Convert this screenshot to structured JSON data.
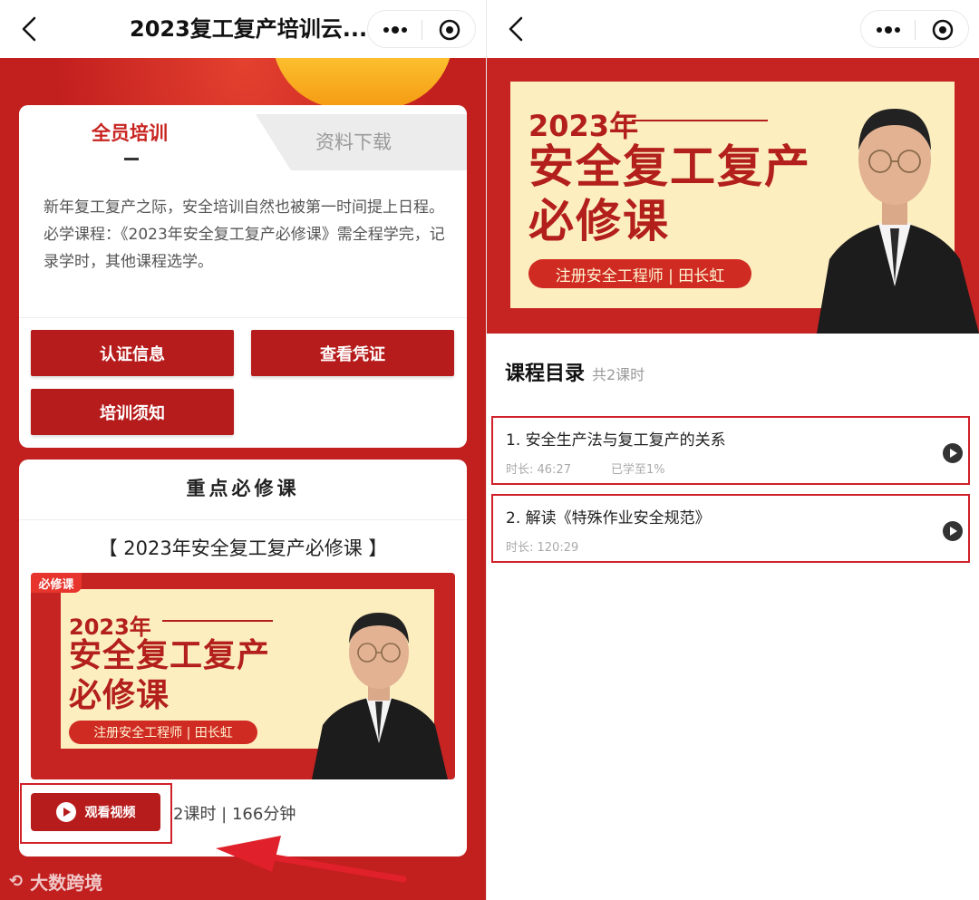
{
  "left": {
    "nav": {
      "title": "2023复工复产培训云..."
    },
    "tabs": [
      {
        "label": "全员培训",
        "active": true
      },
      {
        "label": "资料下载",
        "active": false
      }
    ],
    "intro": {
      "line1": "新年复工复产之际，安全培训自然也被第一时间提上日程。",
      "line2": "必学课程：《2023年安全复工复产必修课》需全程学完，记录学时，其他课程选学。"
    },
    "buttons": {
      "auth": "认证信息",
      "cert": "查看凭证",
      "notice": "培训须知"
    },
    "section_title": "重点必修课",
    "course_title": "【 2023年安全复工复产必修课 】",
    "badge": "必修课",
    "banner": {
      "year": "2023年",
      "main_line1": "安全复工复产",
      "main_line2": "必修课",
      "pill": "注册安全工程师 | 田长虹"
    },
    "watch_button": "观看视频",
    "meta": "2课时 | 166分钟"
  },
  "right": {
    "banner": {
      "year": "2023年",
      "main_line1": "安全复工复产",
      "main_line2": "必修课",
      "pill": "注册安全工程师 | 田长虹"
    },
    "catalog": {
      "title": "课程目录",
      "count": "共2课时"
    },
    "lessons": [
      {
        "title": "1. 安全生产法与复工复产的关系",
        "duration": "时长: 46:27",
        "progress": "已学至1%"
      },
      {
        "title": "2. 解读《特殊作业安全规范》",
        "duration": "时长: 120:29"
      }
    ]
  },
  "watermark": "大数跨境",
  "colors": {
    "brand_red": "#b71c1c",
    "banner_red": "#c62323",
    "cream": "#fdeebf",
    "annotation_red": "#d0202a"
  },
  "icons": [
    "back-arrow-icon",
    "more-dots-icon",
    "close-target-icon",
    "play-icon"
  ]
}
